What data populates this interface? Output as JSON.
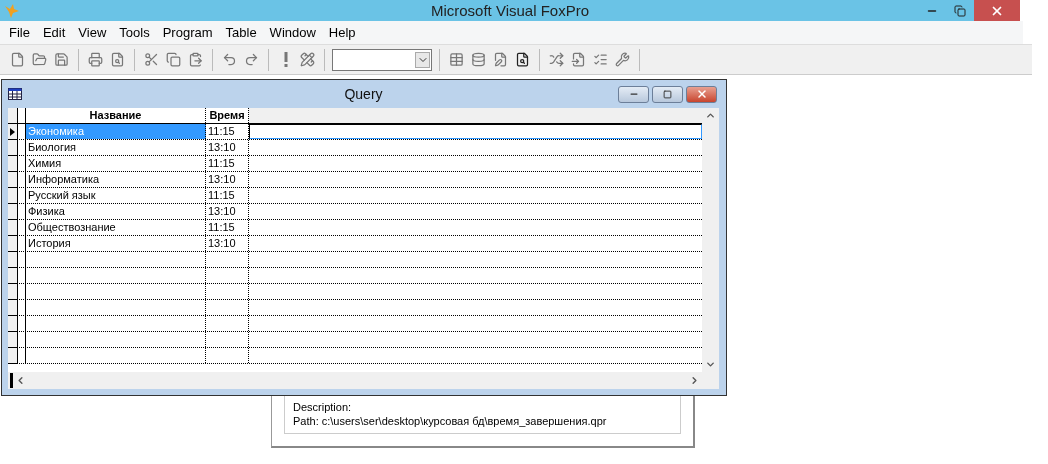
{
  "app": {
    "title": "Microsoft Visual FoxPro"
  },
  "menu": [
    "File",
    "Edit",
    "View",
    "Tools",
    "Program",
    "Table",
    "Window",
    "Help"
  ],
  "query_window": {
    "title": "Query",
    "columns": [
      "Название",
      "Время"
    ],
    "rows": [
      {
        "cells": [
          "Экономика",
          "11:15"
        ],
        "selected": true
      },
      {
        "cells": [
          "Биология",
          "13:10"
        ],
        "selected": false
      },
      {
        "cells": [
          "Химия",
          "11:15"
        ],
        "selected": false
      },
      {
        "cells": [
          "Информатика",
          "13:10"
        ],
        "selected": false
      },
      {
        "cells": [
          "Русский язык",
          "11:15"
        ],
        "selected": false
      },
      {
        "cells": [
          "Физика",
          "13:10"
        ],
        "selected": false
      },
      {
        "cells": [
          "Обществознание",
          "11:15"
        ],
        "selected": false
      },
      {
        "cells": [
          "История",
          "13:10"
        ],
        "selected": false
      }
    ]
  },
  "background_dialog": {
    "description": "Description:",
    "path": "Path: c:\\users\\ser\\desktop\\курсовая бд\\время_завершения.qpr"
  }
}
